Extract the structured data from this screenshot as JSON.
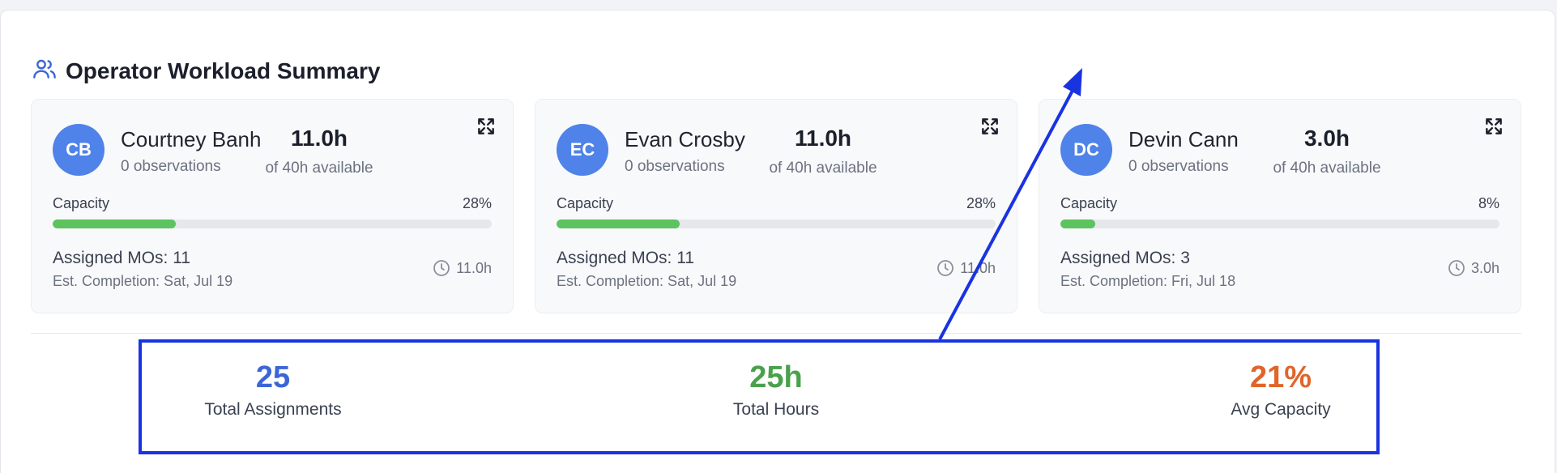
{
  "panel": {
    "title": "Operator Workload Summary",
    "icon": "users-icon"
  },
  "operators": [
    {
      "initials": "CB",
      "name": "Courtney Banh",
      "observations": "0 observations",
      "hours": "11.0h",
      "available": "of 40h available",
      "capacity_label": "Capacity",
      "capacity_pct_text": "28%",
      "capacity_pct": 28,
      "assigned": "Assigned MOs: 11",
      "est_completion": "Est. Completion: Sat, Jul 19",
      "time": "11.0h"
    },
    {
      "initials": "EC",
      "name": "Evan Crosby",
      "observations": "0 observations",
      "hours": "11.0h",
      "available": "of 40h available",
      "capacity_label": "Capacity",
      "capacity_pct_text": "28%",
      "capacity_pct": 28,
      "assigned": "Assigned MOs: 11",
      "est_completion": "Est. Completion: Sat, Jul 19",
      "time": "11.0h"
    },
    {
      "initials": "DC",
      "name": "Devin Cann",
      "observations": "0 observations",
      "hours": "3.0h",
      "available": "of 40h available",
      "capacity_label": "Capacity",
      "capacity_pct_text": "8%",
      "capacity_pct": 8,
      "assigned": "Assigned MOs: 3",
      "est_completion": "Est. Completion: Fri, Jul 18",
      "time": "3.0h"
    }
  ],
  "summary": {
    "total_assignments": {
      "value": "25",
      "label": "Total Assignments",
      "color": "#3b66d6"
    },
    "total_hours": {
      "value": "25h",
      "label": "Total Hours",
      "color": "#4aa14c"
    },
    "avg_capacity": {
      "value": "21%",
      "label": "Avg Capacity",
      "color": "#e0652b"
    }
  },
  "colors": {
    "avatar": "#4f83ea",
    "capacity_bar": "#5cc35f",
    "annotation": "#1a33e0"
  }
}
